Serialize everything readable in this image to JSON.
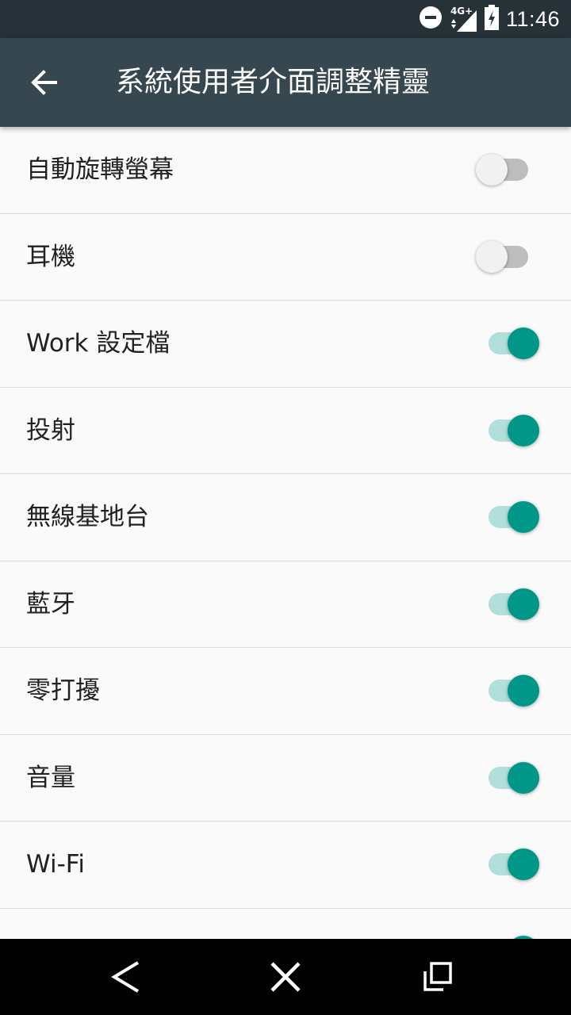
{
  "status_bar": {
    "time": "11:46",
    "network_label": "4G+",
    "icons": [
      "do-not-disturb-icon",
      "signal-icon",
      "battery-charging-icon"
    ]
  },
  "app_bar": {
    "title": "系統使用者介面調整精靈",
    "back_icon": "arrow-back-icon"
  },
  "settings": {
    "items": [
      {
        "label": "自動旋轉螢幕",
        "enabled": false
      },
      {
        "label": "耳機",
        "enabled": false
      },
      {
        "label": "Work 設定檔",
        "enabled": true
      },
      {
        "label": "投射",
        "enabled": true
      },
      {
        "label": "無線基地台",
        "enabled": true
      },
      {
        "label": "藍牙",
        "enabled": true
      },
      {
        "label": "零打擾",
        "enabled": true
      },
      {
        "label": "音量",
        "enabled": true
      },
      {
        "label": "Wi-Fi",
        "enabled": true
      },
      {
        "label": "",
        "enabled": true
      }
    ]
  },
  "nav_bar": {
    "buttons": [
      "nav-back-icon",
      "nav-home-x-icon",
      "nav-recents-icon"
    ]
  },
  "colors": {
    "status_bar": "#263238",
    "app_bar": "#37474f",
    "accent": "#009688",
    "accent_track": "#b2dfdb",
    "off_track": "#bdbdbd",
    "background": "#fafafa"
  }
}
